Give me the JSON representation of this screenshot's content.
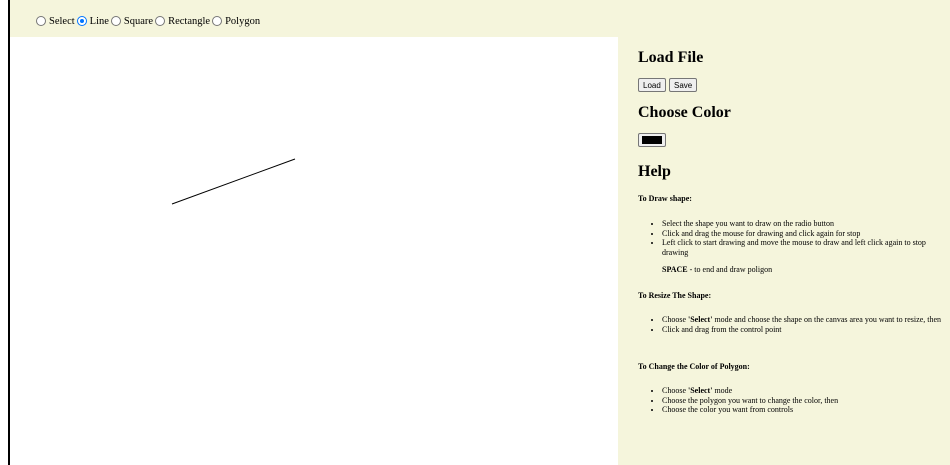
{
  "toolbar": {
    "modes": [
      {
        "label": "Select",
        "checked": false
      },
      {
        "label": "Line",
        "checked": true
      },
      {
        "label": "Square",
        "checked": false
      },
      {
        "label": "Rectangle",
        "checked": false
      },
      {
        "label": "Polygon",
        "checked": false
      }
    ]
  },
  "canvas": {
    "shapes": [
      {
        "type": "line",
        "stroke": "#000000"
      }
    ]
  },
  "panel": {
    "load_file_title": "Load File",
    "load_label": "Load",
    "save_label": "Save",
    "choose_color_title": "Choose Color",
    "current_color": "#000000",
    "help_title": "Help",
    "draw": {
      "heading": "To Draw shape:",
      "items": [
        "Select the shape you want to draw on the radio button",
        "Click and drag the mouse for drawing and click again for stop",
        "Left click to start drawing and move the mouse to draw and left click again to stop drawing"
      ],
      "space_key": "SPACE",
      "space_text": " - to end and draw poligon"
    },
    "resize": {
      "heading": "To Resize The Shape:",
      "items": [
        {
          "pre": "Choose ",
          "bold": "'Select'",
          "post": " mode and choose the shape on the canvas area you want to resize, then"
        },
        {
          "pre": "Click and drag from the control point",
          "bold": "",
          "post": ""
        }
      ]
    },
    "color": {
      "heading": "To Change the Color of Polygon:",
      "items": [
        {
          "pre": "Choose ",
          "bold": "'Select'",
          "post": " mode"
        },
        {
          "pre": "Choose the polygon you want to change the color, then",
          "bold": "",
          "post": ""
        },
        {
          "pre": "Choose the color you want from controls",
          "bold": "",
          "post": ""
        }
      ]
    }
  }
}
